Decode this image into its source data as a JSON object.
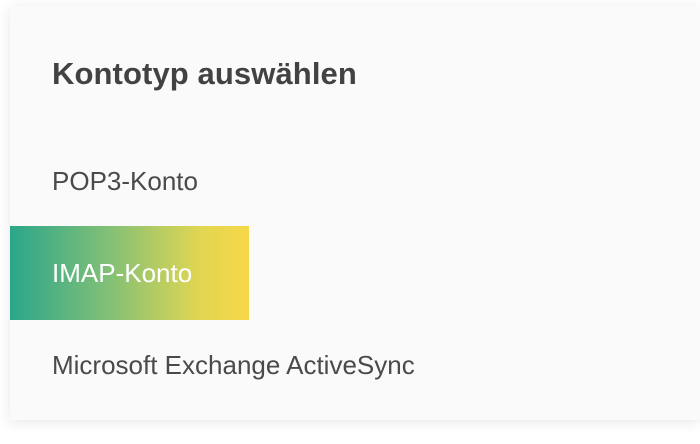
{
  "dialog": {
    "title": "Kontotyp auswählen",
    "options": [
      {
        "label": "POP3-Konto",
        "highlighted": false
      },
      {
        "label": "IMAP-Konto",
        "highlighted": true
      },
      {
        "label": "Microsoft Exchange ActiveSync",
        "highlighted": false
      }
    ]
  },
  "colors": {
    "highlight_gradient_start": "#2ba68a",
    "highlight_gradient_end": "#f7d748",
    "title_text": "#424242",
    "option_text": "#4a4a4a"
  }
}
